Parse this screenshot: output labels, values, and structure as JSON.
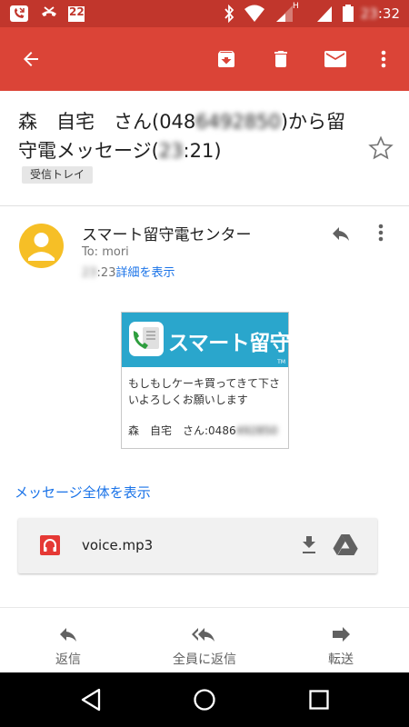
{
  "status_bar": {
    "icons": [
      "missed-call-app-icon",
      "missed-call-icon",
      "calendar-icon",
      "bluetooth-icon",
      "wifi-icon",
      "signal-icon",
      "battery-icon"
    ],
    "calendar_day": "22",
    "network_label": "H",
    "time_hidden": "23",
    "time_minutes": ":32"
  },
  "app_bar": {
    "icons": [
      "back-arrow-icon",
      "archive-icon",
      "delete-icon",
      "mark-unread-icon",
      "more-vert-icon"
    ],
    "background": "#db4437"
  },
  "email": {
    "subject_part1": "森　自宅　さん(048",
    "subject_hidden1": "6492850",
    "subject_part2": ")から留守電メッセージ(",
    "subject_hidden2": "23",
    "subject_part3": ":21)",
    "label": "受信トレイ",
    "sender_name": "スマート留守電センター",
    "to": "To: mori",
    "time_hidden": "23",
    "time_visible": ":23",
    "details_link": "詳細を表示"
  },
  "card": {
    "brand": "スマート留守電",
    "tm": "TM",
    "message": "もしもしケーキ買ってきて下さいよろしくお願いします",
    "signature_prefix": "森　自宅　さん:0486",
    "signature_hidden": "492850",
    "header_color": "#2aa6cc"
  },
  "show_full_message": "メッセージ全体を表示",
  "attachment": {
    "filename": "voice.mp3",
    "type_icon": "audio-file-icon",
    "icons": [
      "download-icon",
      "drive-icon"
    ]
  },
  "actions": {
    "reply": "返信",
    "reply_all": "全員に返信",
    "forward": "転送"
  },
  "nav_bar": {
    "icons": [
      "back-triangle-icon",
      "home-circle-icon",
      "recents-square-icon"
    ]
  },
  "colors": {
    "status_bar": "#c1362c",
    "avatar": "#f6bf26",
    "link": "#1a73e8",
    "accent": "#db4437"
  }
}
